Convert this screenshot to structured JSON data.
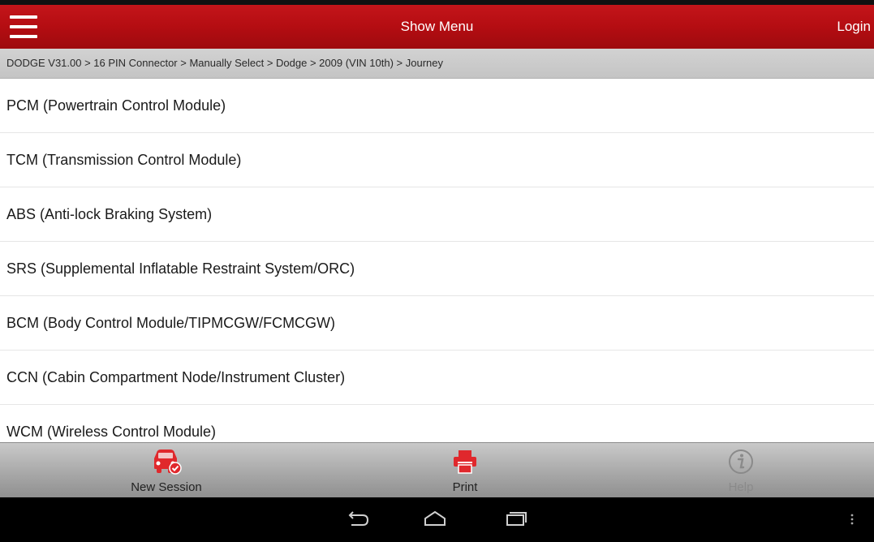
{
  "header": {
    "title": "Show Menu",
    "login_label": "Login"
  },
  "breadcrumb": {
    "text": "DODGE V31.00 > 16 PIN Connector > Manually Select > Dodge > 2009 (VIN 10th) > Journey"
  },
  "modules": [
    {
      "label": "PCM (Powertrain Control Module)"
    },
    {
      "label": "TCM (Transmission Control Module)"
    },
    {
      "label": "ABS (Anti-lock Braking System)"
    },
    {
      "label": "SRS (Supplemental Inflatable Restraint System/ORC)"
    },
    {
      "label": "BCM (Body Control Module/TIPMCGW/FCMCGW)"
    },
    {
      "label": "CCN (Cabin Compartment Node/Instrument Cluster)"
    },
    {
      "label": "WCM (Wireless Control Module)"
    }
  ],
  "toolbar": {
    "new_session_label": "New Session",
    "print_label": "Print",
    "help_label": "Help"
  },
  "icons": {
    "menu": "hamburger-icon",
    "new_session": "car-check-icon",
    "print": "printer-icon",
    "help": "info-icon",
    "back": "back-icon",
    "home": "home-icon",
    "recent": "recent-apps-icon",
    "overflow": "overflow-icon"
  },
  "colors": {
    "header_red": "#b40d12",
    "accent_red": "#e0282c",
    "breadcrumb_bg": "#cccccc",
    "toolbar_bg": "#a8a8a8",
    "help_disabled": "#9a9a9a"
  }
}
